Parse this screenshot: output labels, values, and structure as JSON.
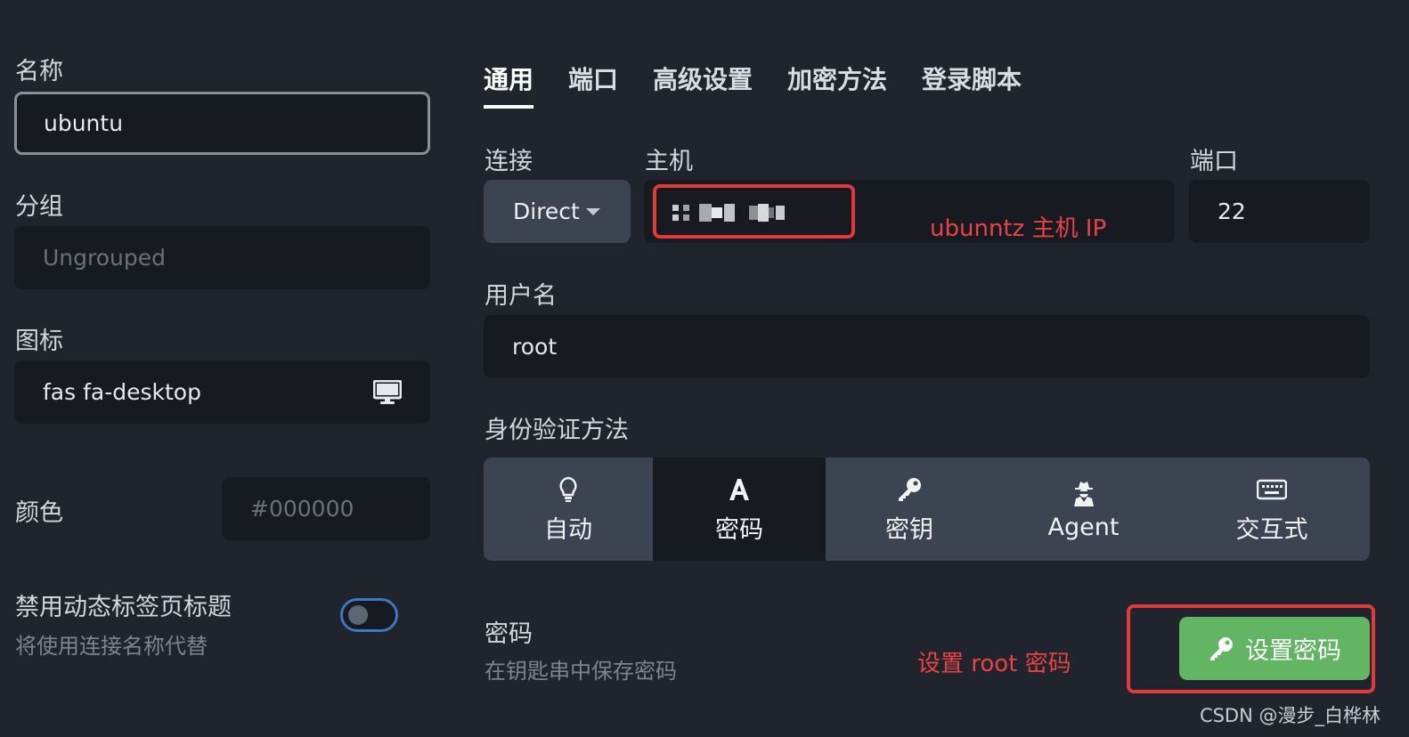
{
  "left": {
    "name_label": "名称",
    "name_value": "ubuntu",
    "group_label": "分组",
    "group_placeholder": "Ungrouped",
    "icon_label": "图标",
    "icon_value": "fas fa-desktop",
    "color_label": "颜色",
    "color_placeholder": "#000000",
    "disable_title_label": "禁用动态标签页标题",
    "disable_title_hint": "将使用连接名称代替",
    "disable_title_toggle_on": false
  },
  "tabs": [
    {
      "label": "通用",
      "active": true
    },
    {
      "label": "端口",
      "active": false
    },
    {
      "label": "高级设置",
      "active": false
    },
    {
      "label": "加密方法",
      "active": false
    },
    {
      "label": "登录脚本",
      "active": false
    }
  ],
  "connection": {
    "connect_label": "连接",
    "connect_value": "Direct",
    "host_label": "主机",
    "port_label": "端口",
    "port_value": "22",
    "username_label": "用户名",
    "username_value": "root"
  },
  "auth": {
    "label": "身份验证方法",
    "options": [
      {
        "label": "自动",
        "icon": "lightbulb-icon",
        "active": false
      },
      {
        "label": "密码",
        "icon": "font-a-icon",
        "active": true
      },
      {
        "label": "密钥",
        "icon": "key-icon",
        "active": false
      },
      {
        "label": "Agent",
        "icon": "user-secret-icon",
        "active": false
      },
      {
        "label": "交互式",
        "icon": "keyboard-icon",
        "active": false
      }
    ]
  },
  "password": {
    "label": "密码",
    "hint": "在钥匙串中保存密码",
    "set_button": "设置密码"
  },
  "annotations": {
    "host_note": "ubunntz 主机 IP",
    "password_note": "设置 root 密码"
  },
  "watermark": "CSDN @漫步_白桦林",
  "colors": {
    "background": "#20252d",
    "field": "#171b21",
    "accent_green": "#62b562",
    "annotation_red": "#e23a3a"
  }
}
